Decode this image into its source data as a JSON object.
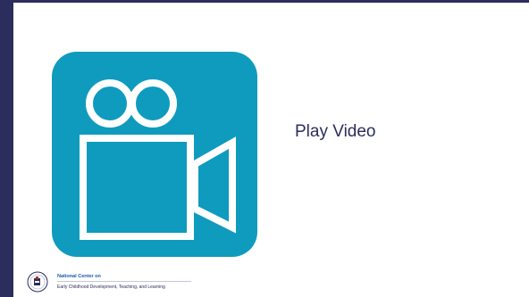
{
  "slide": {
    "play_label": "Play Video"
  },
  "footer": {
    "org_line1": "National Center on",
    "org_line2": "Early Childhood Development, Teaching, and Learning",
    "seal_text": "Office of Head Start"
  },
  "colors": {
    "accent_bar": "#2b2d5c",
    "video_tile": "#0f9bbd",
    "label_text": "#2b2d5c"
  },
  "icons": {
    "video": "video-camera-icon",
    "seal": "head-start-seal-icon"
  }
}
